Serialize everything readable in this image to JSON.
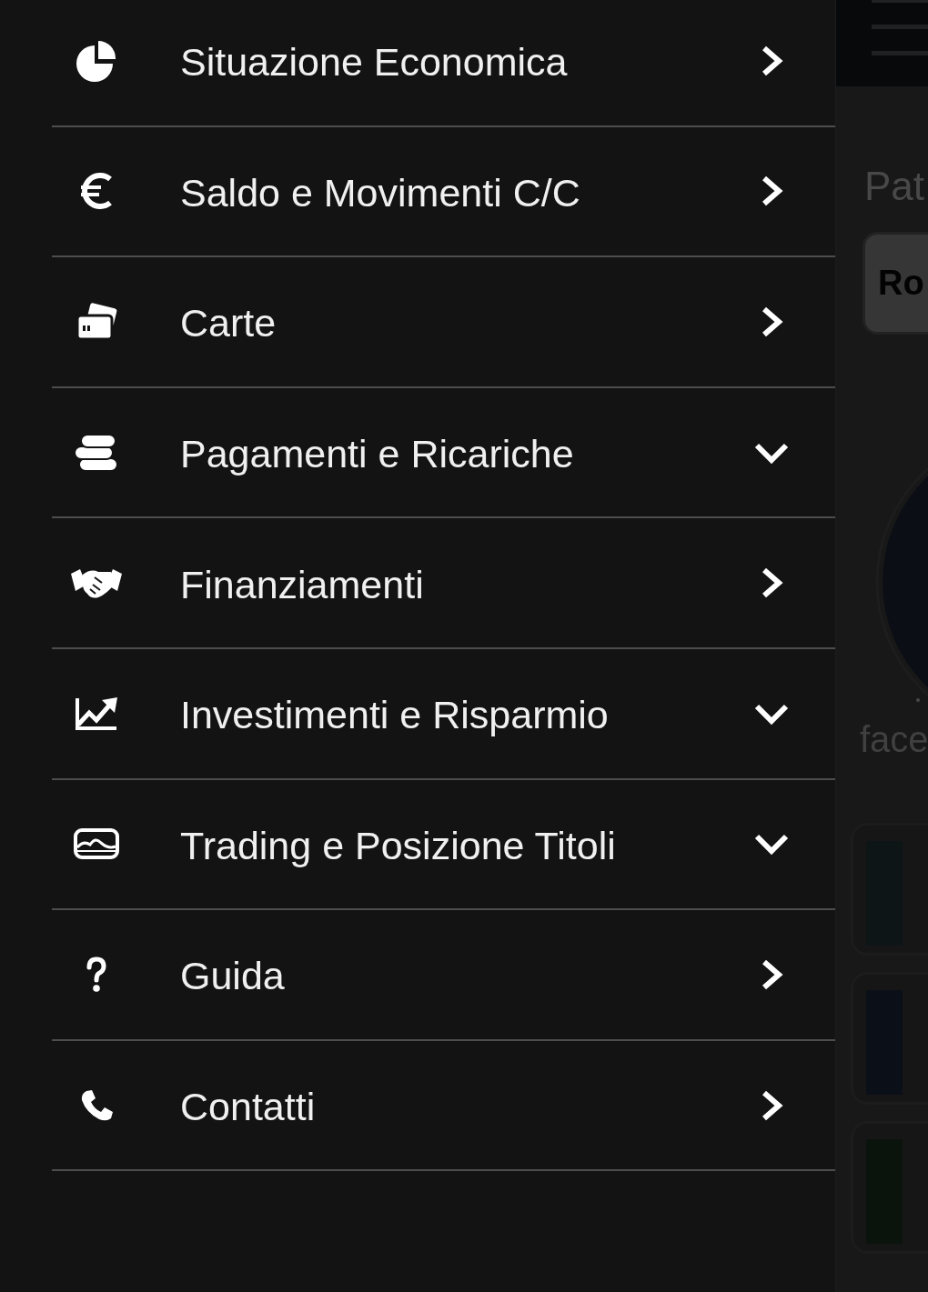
{
  "menu": {
    "items": [
      {
        "label": "Situazione Economica",
        "kind": "link"
      },
      {
        "label": "Saldo e Movimenti C/C",
        "kind": "link"
      },
      {
        "label": "Carte",
        "kind": "link"
      },
      {
        "label": "Pagamenti e Ricariche",
        "kind": "group"
      },
      {
        "label": "Finanziamenti",
        "kind": "link"
      },
      {
        "label": "Investimenti e Risparmio",
        "kind": "group"
      },
      {
        "label": "Trading e Posizione Titoli",
        "kind": "group"
      },
      {
        "label": "Guida",
        "kind": "link"
      },
      {
        "label": "Contatti",
        "kind": "link"
      }
    ]
  },
  "backdrop": {
    "heading": "Pat",
    "field_value": "Ro",
    "caption": "face",
    "cards": [
      {
        "color": "#0e1517"
      },
      {
        "color": "#0b0f17"
      },
      {
        "color": "#0a140c"
      }
    ]
  }
}
